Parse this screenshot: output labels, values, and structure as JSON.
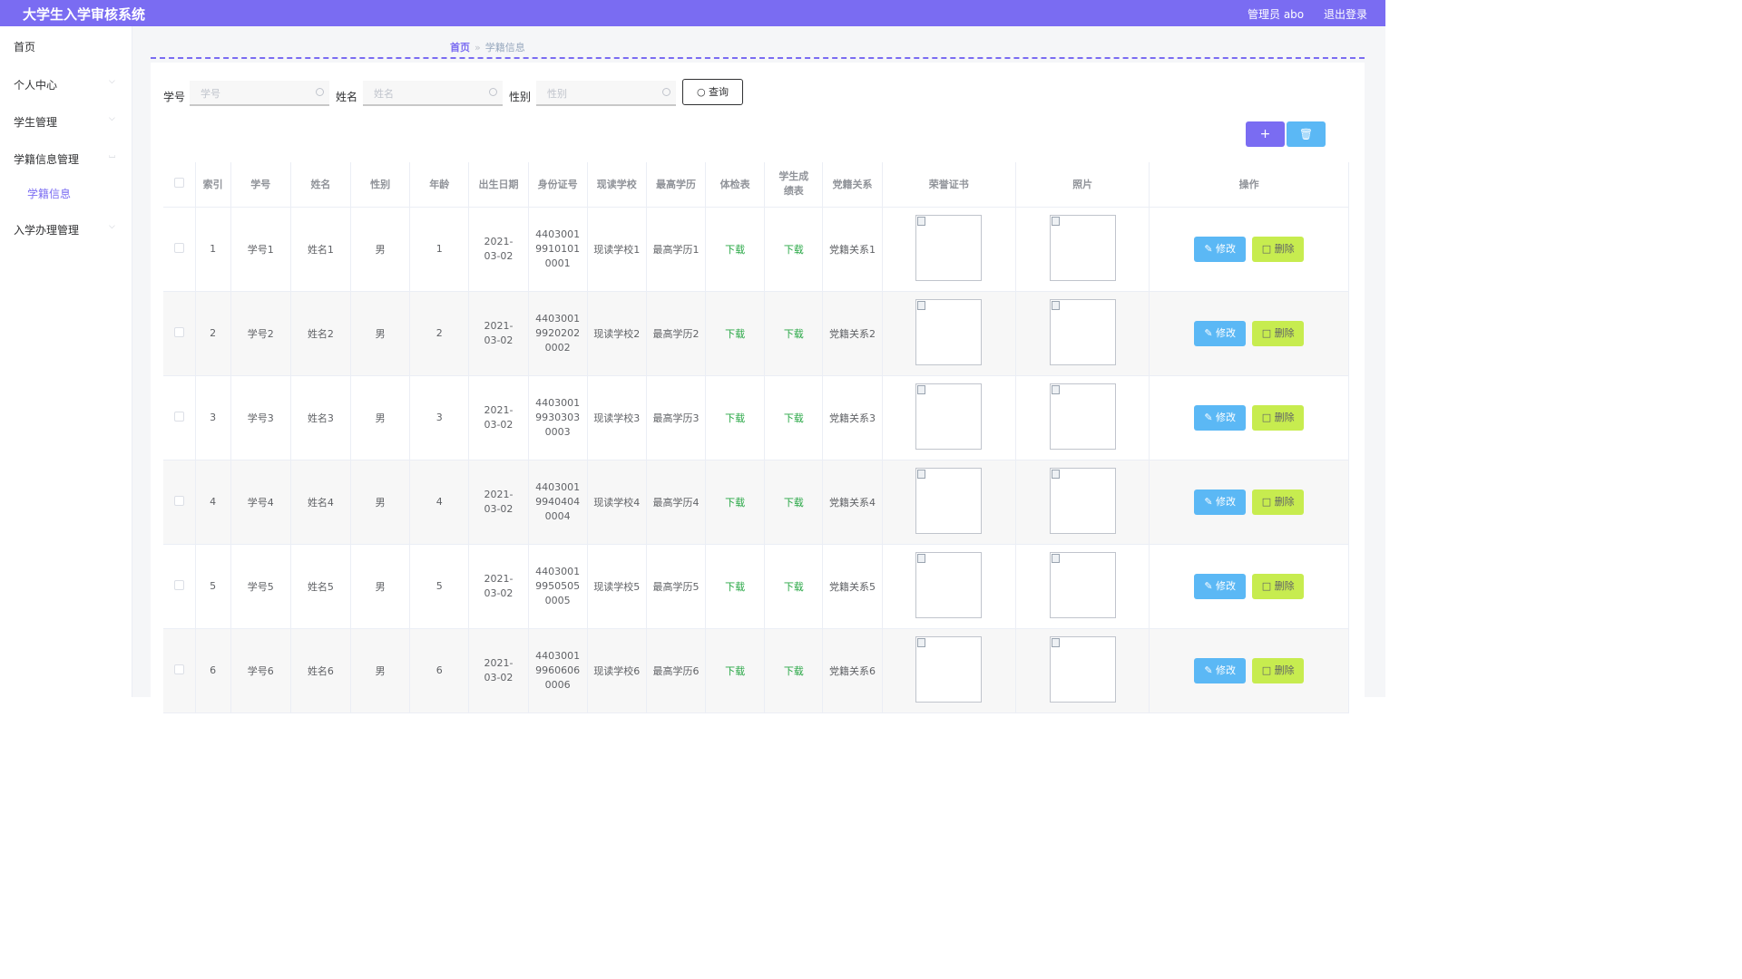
{
  "header": {
    "title": "大学生入学审核系统",
    "user": "管理员 abo",
    "logout": "退出登录"
  },
  "sidebar": {
    "items": [
      {
        "label": "首页",
        "expandable": false
      },
      {
        "label": "个人中心",
        "expandable": true
      },
      {
        "label": "学生管理",
        "expandable": true
      },
      {
        "label": "学籍信息管理",
        "expandable": true,
        "expanded": true
      },
      {
        "label": "入学办理管理",
        "expandable": true
      }
    ],
    "sub_item": "学籍信息"
  },
  "breadcrumb": {
    "home": "首页",
    "separator": "»",
    "current": "学籍信息"
  },
  "search": {
    "fields": [
      {
        "label": "学号",
        "placeholder": "学号"
      },
      {
        "label": "姓名",
        "placeholder": "姓名"
      },
      {
        "label": "性别",
        "placeholder": "性别"
      }
    ],
    "query_button": "查询"
  },
  "actions": {
    "add": "+",
    "delete": "🗑"
  },
  "table": {
    "headers": [
      "",
      "索引",
      "学号",
      "姓名",
      "性别",
      "年龄",
      "出生日期",
      "身份证号",
      "现读学校",
      "最高学历",
      "体检表",
      "学生成绩表",
      "党籍关系",
      "荣誉证书",
      "照片",
      "操作"
    ],
    "edit_label": "修改",
    "delete_label": "删除",
    "download_label": "下载",
    "rows": [
      {
        "index": "1",
        "sid": "学号1",
        "name": "姓名1",
        "gender": "男",
        "age": "1",
        "birth": "2021-03-02",
        "idno": "440300199101010001",
        "school": "现读学校1",
        "edu": "最高学历1",
        "party": "党籍关系1"
      },
      {
        "index": "2",
        "sid": "学号2",
        "name": "姓名2",
        "gender": "男",
        "age": "2",
        "birth": "2021-03-02",
        "idno": "440300199202020002",
        "school": "现读学校2",
        "edu": "最高学历2",
        "party": "党籍关系2"
      },
      {
        "index": "3",
        "sid": "学号3",
        "name": "姓名3",
        "gender": "男",
        "age": "3",
        "birth": "2021-03-02",
        "idno": "440300199303030003",
        "school": "现读学校3",
        "edu": "最高学历3",
        "party": "党籍关系3"
      },
      {
        "index": "4",
        "sid": "学号4",
        "name": "姓名4",
        "gender": "男",
        "age": "4",
        "birth": "2021-03-02",
        "idno": "440300199404040004",
        "school": "现读学校4",
        "edu": "最高学历4",
        "party": "党籍关系4"
      },
      {
        "index": "5",
        "sid": "学号5",
        "name": "姓名5",
        "gender": "男",
        "age": "5",
        "birth": "2021-03-02",
        "idno": "440300199505050005",
        "school": "现读学校5",
        "edu": "最高学历5",
        "party": "党籍关系5"
      },
      {
        "index": "6",
        "sid": "学号6",
        "name": "姓名6",
        "gender": "男",
        "age": "6",
        "birth": "2021-03-02",
        "idno": "440300199606060006",
        "school": "现读学校6",
        "edu": "最高学历6",
        "party": "党籍关系6"
      }
    ]
  }
}
